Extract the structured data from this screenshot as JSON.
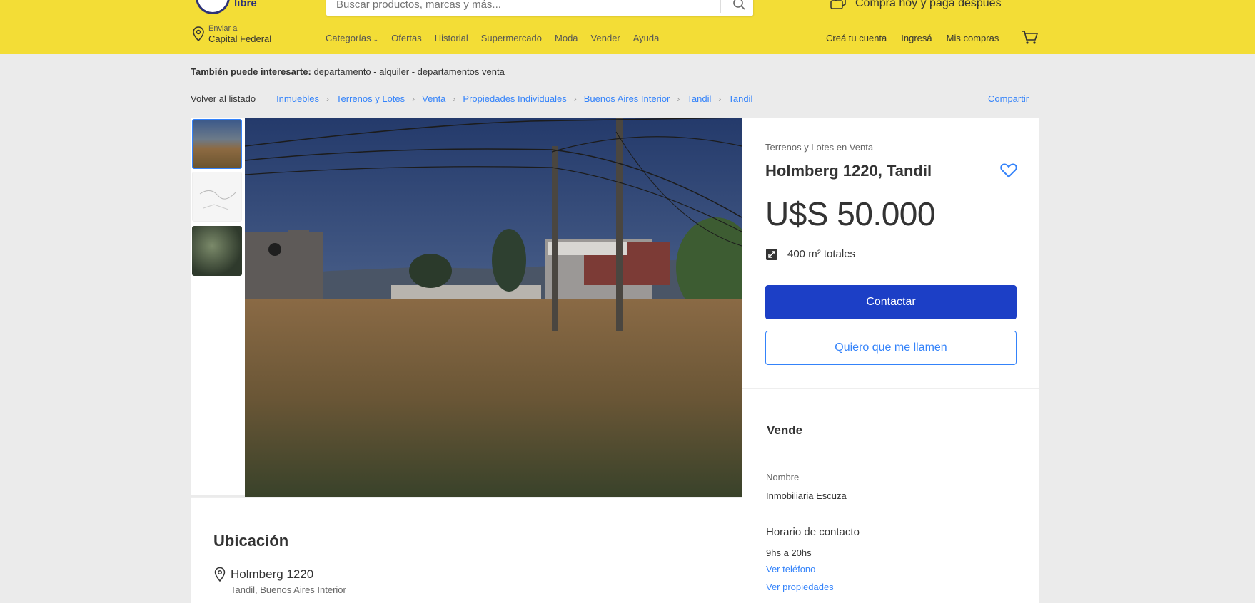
{
  "header": {
    "logo_text": "libre",
    "search_placeholder": "Buscar productos, marcas y más...",
    "promo": "Comprá hoy y pagá después",
    "location_label": "Enviar a",
    "location_city": "Capital Federal",
    "nav": [
      "Categorías",
      "Ofertas",
      "Historial",
      "Supermercado",
      "Moda",
      "Vender",
      "Ayuda"
    ],
    "account": [
      "Creá tu cuenta",
      "Ingresá",
      "Mis compras"
    ]
  },
  "related": {
    "label": "También puede interesarte:",
    "items": "departamento - alquiler - departamentos venta"
  },
  "breadcrumb": {
    "back": "Volver al listado",
    "items": [
      "Inmuebles",
      "Terrenos y Lotes",
      "Venta",
      "Propiedades Individuales",
      "Buenos Aires Interior",
      "Tandil",
      "Tandil"
    ],
    "share": "Compartir"
  },
  "listing": {
    "subtitle": "Terrenos y Lotes en Venta",
    "title": "Holmberg 1220, Tandil",
    "price": "U$S 50.000",
    "area": "400 m² totales",
    "contact_button": "Contactar",
    "call_button": "Quiero que me llamen"
  },
  "seller": {
    "heading": "Vende",
    "name_label": "Nombre",
    "name_value": "Inmobiliaria Escuza",
    "hours_label": "Horario de contacto",
    "hours_value": "9hs a 20hs",
    "phone_link": "Ver teléfono",
    "props_link": "Ver propiedades"
  },
  "location": {
    "heading": "Ubicación",
    "address": "Holmberg 1220",
    "area": "Tandil, Buenos Aires Interior"
  },
  "colors": {
    "header_bg": "#f3dd36",
    "primary": "#1c3fc6",
    "link": "#3483fa"
  }
}
